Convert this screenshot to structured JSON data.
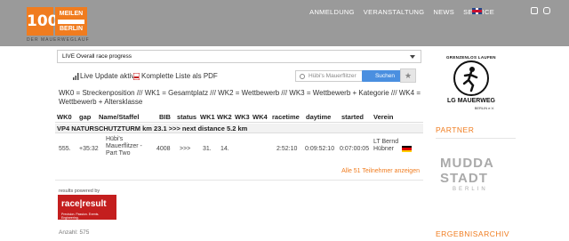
{
  "header": {
    "logo_number": "100",
    "logo_line1": "MEILEN",
    "logo_line2": "BERLIN",
    "logo_tagline": "DER MAUERWEGLAUF",
    "nav": [
      "ANMELDUNG",
      "VERANSTALTUNG",
      "NEWS",
      "SERVICE"
    ],
    "language_icon": "uk-flag-icon",
    "social_icons": [
      "facebook-icon",
      "instagram-icon"
    ]
  },
  "main": {
    "contest_select": "LIVE Overall race progress",
    "live_update_label": "Live Update aktiv",
    "pdf_link": "Komplette Liste als PDF",
    "search_placeholder": "Hübi's Mauerflitzer",
    "search_button": "Suchen",
    "legend": "WK0 = Streckenposition /// WK1 = Gesamtplatz /// WK2 = Wettbewerb /// WK3 = Wettbewerb + Kategorie /// WK4 = Wettbewerb + Altersklasse",
    "columns": [
      "WK0",
      "gap",
      "Name/Staffel",
      "BIB",
      "status",
      "WK1",
      "WK2",
      "WK3",
      "WK4",
      "racetime",
      "daytime",
      "started",
      "Verein"
    ],
    "group_label": "VP4 NATURSCHUTZTURM km 23.1 >>> next distance 5.2 km",
    "rows": [
      {
        "wk0": "555.",
        "gap": "+35:32",
        "name": "Hübi's Mauerflitzer - Part Two",
        "bib": "4008",
        "status": ">>>",
        "wk1": "31.",
        "wk2": "14.",
        "wk3": "",
        "wk4": "",
        "racetime": "2:52:10",
        "daytime": "0:09:52:10",
        "started": "0:07:00:05",
        "verein": "LT Bernd Hübner",
        "flag_icon": "germany-flag-icon"
      }
    ],
    "show_all": "Alle 51 Teilnehmer anzeigen",
    "powered_by": "results powered by",
    "race_result_logo": "race|result",
    "race_result_tagline": "Precision. Passion. Events. Engineering.",
    "count": "Anzahl: 575"
  },
  "sidebar": {
    "club_logo_arc": "GRENZENLOS LAUFEN",
    "club_logo_name": "LG MAUERWEG",
    "club_logo_sub": "BERLIN e.V.",
    "partner_heading": "PARTNER",
    "partner_logo_top": "MUDDA",
    "partner_logo_mid": "STADT",
    "partner_logo_bottom": "BERLIN",
    "archive_heading": "ERGEBNISARCHIV"
  },
  "colors": {
    "accent": "#f07c1f",
    "header_bg": "#9a9a9a",
    "search_button": "#4a8fe0",
    "race_result_red": "#c41e1e"
  }
}
